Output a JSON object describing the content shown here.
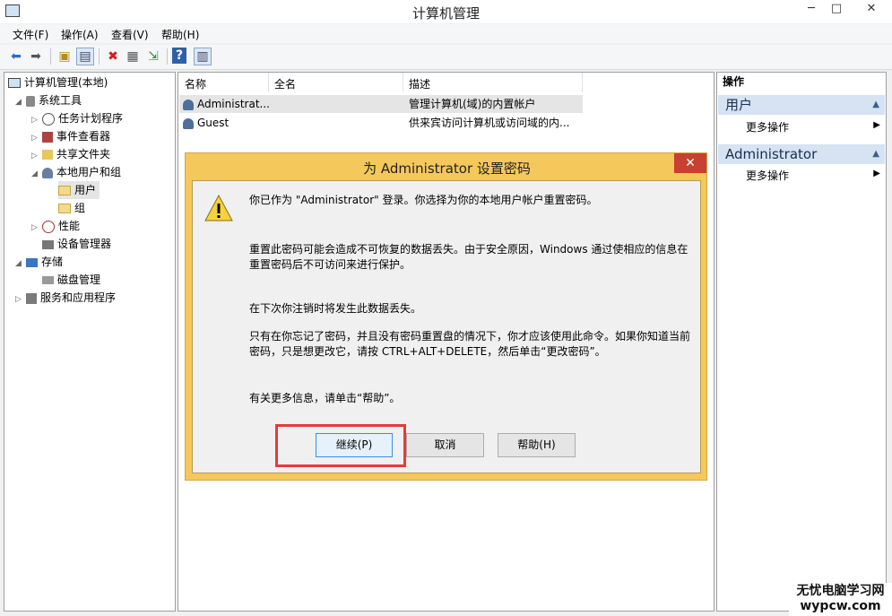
{
  "window": {
    "title": "计算机管理",
    "min_glyph": "─",
    "max_glyph": "□",
    "close_glyph": "✕"
  },
  "menu": [
    "文件(F)",
    "操作(A)",
    "查看(V)",
    "帮助(H)"
  ],
  "toolbar": {
    "icons": [
      "back-icon",
      "forward-icon",
      "up-folder-icon",
      "show-tree-icon",
      "delete-icon",
      "properties-icon",
      "export-icon",
      "help-icon",
      "console-icon"
    ]
  },
  "tree": [
    {
      "label": "计算机管理(本地)",
      "icon": "computer-icon",
      "toggle": ""
    },
    {
      "label": "系统工具",
      "icon": "tools-icon",
      "toggle": "◢"
    },
    {
      "label": "任务计划程序",
      "icon": "clock-icon",
      "toggle": "▷"
    },
    {
      "label": "事件查看器",
      "icon": "event-viewer-icon",
      "toggle": "▷"
    },
    {
      "label": "共享文件夹",
      "icon": "shared-folder-icon",
      "toggle": "▷"
    },
    {
      "label": "本地用户和组",
      "icon": "users-icon",
      "toggle": "◢"
    },
    {
      "label": "用户",
      "icon": "folder-icon",
      "toggle": ""
    },
    {
      "label": "组",
      "icon": "folder-icon",
      "toggle": ""
    },
    {
      "label": "性能",
      "icon": "performance-icon",
      "toggle": "▷"
    },
    {
      "label": "设备管理器",
      "icon": "device-manager-icon",
      "toggle": ""
    },
    {
      "label": "存储",
      "icon": "storage-icon",
      "toggle": "◢"
    },
    {
      "label": "磁盘管理",
      "icon": "disk-icon",
      "toggle": ""
    },
    {
      "label": "服务和应用程序",
      "icon": "services-icon",
      "toggle": "▷"
    }
  ],
  "list": {
    "columns": [
      "名称",
      "全名",
      "描述"
    ],
    "rows": [
      {
        "name": "Administrat...",
        "fullname": "",
        "description": "管理计算机(域)的内置帐户"
      },
      {
        "name": "Guest",
        "fullname": "",
        "description": "供来宾访问计算机或访问域的内..."
      }
    ]
  },
  "actions": {
    "header": "操作",
    "sections": [
      {
        "title": "用户",
        "items": [
          "更多操作"
        ]
      },
      {
        "title": "Administrator",
        "items": [
          "更多操作"
        ]
      }
    ],
    "collapse_glyph": "▲",
    "arrow_glyph": "▶"
  },
  "dialog": {
    "title": "为 Administrator 设置密码",
    "close_glyph": "✕",
    "icon": "warning-icon",
    "paragraphs": [
      "你已作为 \"Administrator\" 登录。你选择为你的本地用户帐户重置密码。",
      "重置此密码可能会造成不可恢复的数据丢失。由于安全原因，Windows 通过使相应的信息在重置密码后不可访问来进行保护。",
      "在下次你注销时将发生此数据丢失。",
      "只有在你忘记了密码，并且没有密码重置盘的情况下，你才应该使用此命令。如果你知道当前密码，只是想更改它，请按 CTRL+ALT+DELETE，然后单击“更改密码”。",
      "有关更多信息，请单击“帮助”。"
    ],
    "buttons": {
      "continue": "继续(P)",
      "cancel": "取消",
      "help": "帮助(H)"
    },
    "highlight_color": "#e63b3b"
  },
  "watermark": {
    "line1": "无忧电脑学习网",
    "line2": "wypcw.com"
  }
}
